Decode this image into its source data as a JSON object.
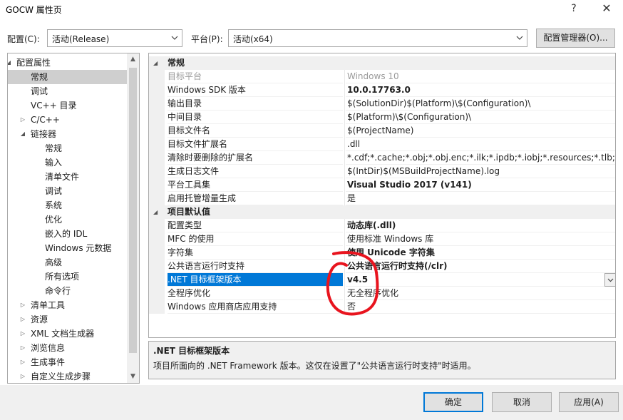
{
  "window": {
    "title": "GOCW 属性页",
    "help": "?",
    "close": "✕"
  },
  "config": {
    "config_label": "配置(C):",
    "config_value": "活动(Release)",
    "platform_label": "平台(P):",
    "platform_value": "活动(x64)",
    "manager_button": "配置管理器(O)..."
  },
  "tree": {
    "items": [
      {
        "label": "配置属性",
        "expander": "◢"
      },
      {
        "label": "常规"
      },
      {
        "label": "调试"
      },
      {
        "label": "VC++ 目录"
      },
      {
        "label": "C/C++",
        "expander": "▷"
      },
      {
        "label": "链接器",
        "expander": "◢"
      },
      {
        "label": "常规"
      },
      {
        "label": "输入"
      },
      {
        "label": "清单文件"
      },
      {
        "label": "调试"
      },
      {
        "label": "系统"
      },
      {
        "label": "优化"
      },
      {
        "label": "嵌入的 IDL"
      },
      {
        "label": "Windows 元数据"
      },
      {
        "label": "高级"
      },
      {
        "label": "所有选项"
      },
      {
        "label": "命令行"
      },
      {
        "label": "清单工具",
        "expander": "▷"
      },
      {
        "label": "资源",
        "expander": "▷"
      },
      {
        "label": "XML 文档生成器",
        "expander": "▷"
      },
      {
        "label": "浏览信息",
        "expander": "▷"
      },
      {
        "label": "生成事件",
        "expander": "▷"
      },
      {
        "label": "自定义生成步骤",
        "expander": "▷"
      }
    ]
  },
  "grid": {
    "categories": [
      {
        "label": "常规",
        "expander": "◢"
      },
      {
        "label": "项目默认值",
        "expander": "◢"
      }
    ],
    "general": [
      {
        "name": "目标平台",
        "value": "Windows 10"
      },
      {
        "name": "Windows SDK 版本",
        "value": "10.0.17763.0"
      },
      {
        "name": "输出目录",
        "value": "$(SolutionDir)$(Platform)\\$(Configuration)\\"
      },
      {
        "name": "中间目录",
        "value": "$(Platform)\\$(Configuration)\\"
      },
      {
        "name": "目标文件名",
        "value": "$(ProjectName)"
      },
      {
        "name": "目标文件扩展名",
        "value": ".dll"
      },
      {
        "name": "清除时要删除的扩展名",
        "value": "*.cdf;*.cache;*.obj;*.obj.enc;*.ilk;*.ipdb;*.iobj;*.resources;*.tlb;*.tli;*.t"
      },
      {
        "name": "生成日志文件",
        "value": "$(IntDir)$(MSBuildProjectName).log"
      },
      {
        "name": "平台工具集",
        "value": "Visual Studio 2017 (v141)"
      },
      {
        "name": "启用托管增量生成",
        "value": "是"
      }
    ],
    "defaults": [
      {
        "name": "配置类型",
        "value": "动态库(.dll)"
      },
      {
        "name": "MFC 的使用",
        "value": "使用标准 Windows 库"
      },
      {
        "name": "字符集",
        "value": "使用 Unicode 字符集"
      },
      {
        "name": "公共语言运行时支持",
        "value": "公共语言运行时支持(/clr)"
      },
      {
        "name": ".NET 目标框架版本",
        "value": "v4.5"
      },
      {
        "name": "全程序优化",
        "value": "无全程序优化"
      },
      {
        "name": "Windows 应用商店应用支持",
        "value": "否"
      }
    ]
  },
  "description": {
    "title": ".NET 目标框架版本",
    "text": "项目所面向的 .NET Framework 版本。这仅在设置了\"公共语言运行时支持\"时适用。"
  },
  "buttons": {
    "ok": "确定",
    "cancel": "取消",
    "apply": "应用(A)"
  },
  "colors": {
    "selection": "#0078d7",
    "annotation": "#e8141e"
  }
}
